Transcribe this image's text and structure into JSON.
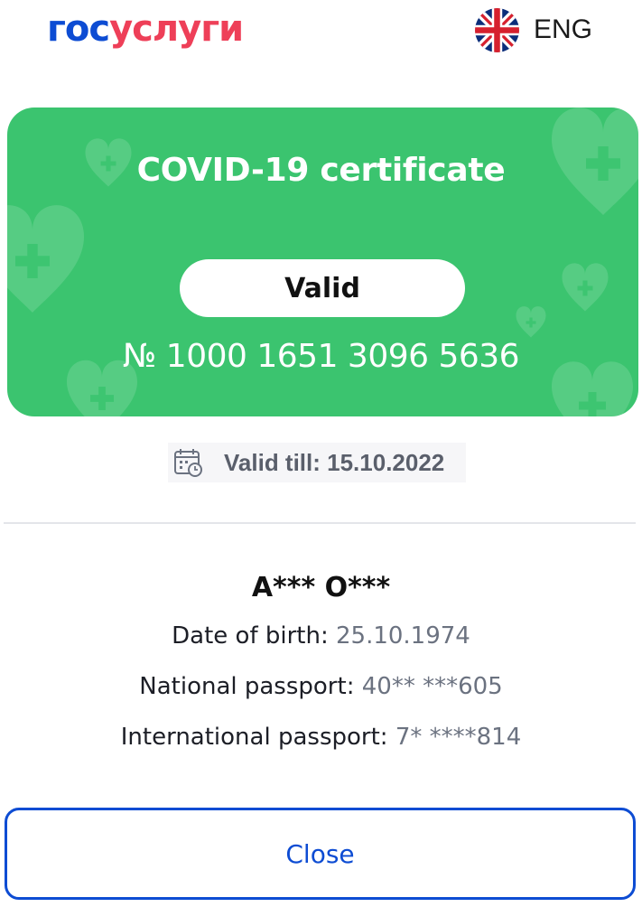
{
  "header": {
    "logo_part1": "гос",
    "logo_part2": "услуги",
    "language_label": "ENG",
    "flag_icon": "uk-flag-icon"
  },
  "certificate": {
    "title": "COVID-19 certificate",
    "status": "Valid",
    "number": "№ 1000 1651 3096 5636",
    "decor_icon": "heart-plus-icon"
  },
  "validity": {
    "icon": "calendar-icon",
    "text": "Valid till: 15.10.2022"
  },
  "person": {
    "name": "A*** O***",
    "dob_label": "Date of birth:",
    "dob_value": "25.10.1974",
    "national_label": "National passport:",
    "national_value": "40** ***605",
    "international_label": "International passport:",
    "international_value": "7* ****814"
  },
  "actions": {
    "close_label": "Close"
  },
  "colors": {
    "brand_blue": "#0d4cd3",
    "brand_red": "#ee3f58",
    "card_green": "#3bc46f"
  }
}
